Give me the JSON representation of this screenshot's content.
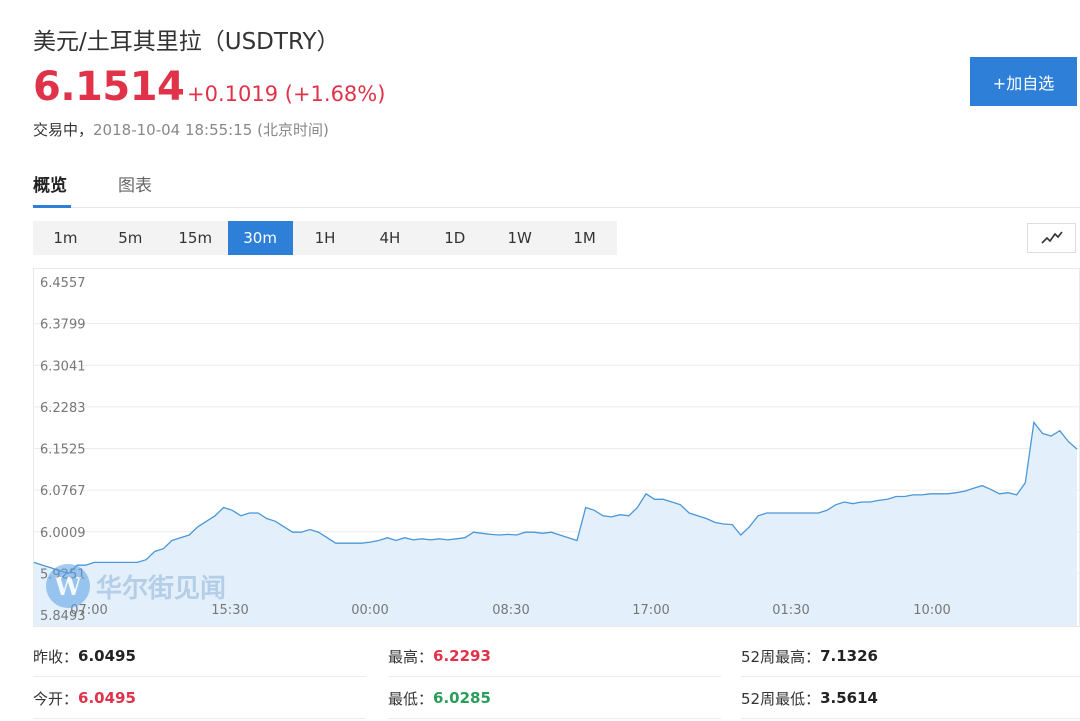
{
  "header": {
    "title": "美元/土耳其里拉（USDTRY）",
    "price": "6.1514",
    "change": "+0.1019 (+1.68%)",
    "status_label": "交易中，",
    "timestamp": "2018-10-04 18:55:15 (北京时间)",
    "add_watchlist_label": "+加自选"
  },
  "tabs": [
    {
      "label": "概览",
      "active": true
    },
    {
      "label": "图表",
      "active": false
    }
  ],
  "intervals": [
    {
      "label": "1m",
      "active": false
    },
    {
      "label": "5m",
      "active": false
    },
    {
      "label": "15m",
      "active": false
    },
    {
      "label": "30m",
      "active": true
    },
    {
      "label": "1H",
      "active": false
    },
    {
      "label": "4H",
      "active": false
    },
    {
      "label": "1D",
      "active": false
    },
    {
      "label": "1W",
      "active": false
    },
    {
      "label": "1M",
      "active": false
    }
  ],
  "chart_type_icon": "line-chart-icon",
  "watermark": {
    "logo_letter": "W",
    "text": "华尔街见闻"
  },
  "colors": {
    "up": "#e0334a",
    "down": "#2a9d5a",
    "accent": "#2d7fd8",
    "line": "#4a97d9",
    "area": "#e3f0fb"
  },
  "chart_data": {
    "type": "area",
    "title": "",
    "xlabel": "",
    "ylabel": "",
    "ylim": [
      5.8493,
      6.4557
    ],
    "y_ticks": [
      "6.4557",
      "6.3799",
      "6.3041",
      "6.2283",
      "6.1525",
      "6.0767",
      "6.0009",
      "5.9251",
      "5.8493"
    ],
    "x_ticks": [
      "07:00",
      "15:30",
      "00:00",
      "08:30",
      "17:00",
      "01:30",
      "10:00"
    ],
    "grid": true,
    "series": [
      {
        "values": [
          5.945,
          5.94,
          5.935,
          5.93,
          5.925,
          5.94,
          5.94,
          5.945,
          5.945,
          5.945,
          5.945,
          5.945,
          5.945,
          5.95,
          5.965,
          5.97,
          5.985,
          5.99,
          5.995,
          6.01,
          6.02,
          6.03,
          6.045,
          6.04,
          6.03,
          6.035,
          6.035,
          6.025,
          6.02,
          6.01,
          6.0,
          6.0,
          6.005,
          6.0,
          5.99,
          5.98,
          5.98,
          5.98,
          5.98,
          5.982,
          5.985,
          5.99,
          5.985,
          5.99,
          5.986,
          5.988,
          5.986,
          5.988,
          5.986,
          5.988,
          5.99,
          6.0,
          5.998,
          5.996,
          5.995,
          5.996,
          5.995,
          6.0,
          6.0,
          5.998,
          6.0,
          5.995,
          5.99,
          5.985,
          6.045,
          6.04,
          6.03,
          6.028,
          6.032,
          6.03,
          6.045,
          6.07,
          6.06,
          6.06,
          6.055,
          6.05,
          6.035,
          6.03,
          6.025,
          6.018,
          6.015,
          6.014,
          5.995,
          6.01,
          6.03,
          6.035,
          6.035,
          6.035,
          6.035,
          6.035,
          6.035,
          6.035,
          6.04,
          6.05,
          6.055,
          6.052,
          6.055,
          6.055,
          6.058,
          6.06,
          6.065,
          6.065,
          6.068,
          6.068,
          6.07,
          6.07,
          6.07,
          6.072,
          6.075,
          6.08,
          6.085,
          6.078,
          6.07,
          6.072,
          6.068,
          6.09,
          6.2,
          6.18,
          6.175,
          6.185,
          6.165,
          6.1514
        ]
      }
    ]
  },
  "stats": [
    {
      "label": "昨收：",
      "value": "6.0495",
      "tone": "neutral"
    },
    {
      "label": "最高：",
      "value": "6.2293",
      "tone": "up"
    },
    {
      "label": "52周最高：",
      "value": "7.1326",
      "tone": "neutral"
    },
    {
      "label": "今开：",
      "value": "6.0495",
      "tone": "up"
    },
    {
      "label": "最低：",
      "value": "6.0285",
      "tone": "down"
    },
    {
      "label": "52周最低：",
      "value": "3.5614",
      "tone": "neutral"
    }
  ]
}
